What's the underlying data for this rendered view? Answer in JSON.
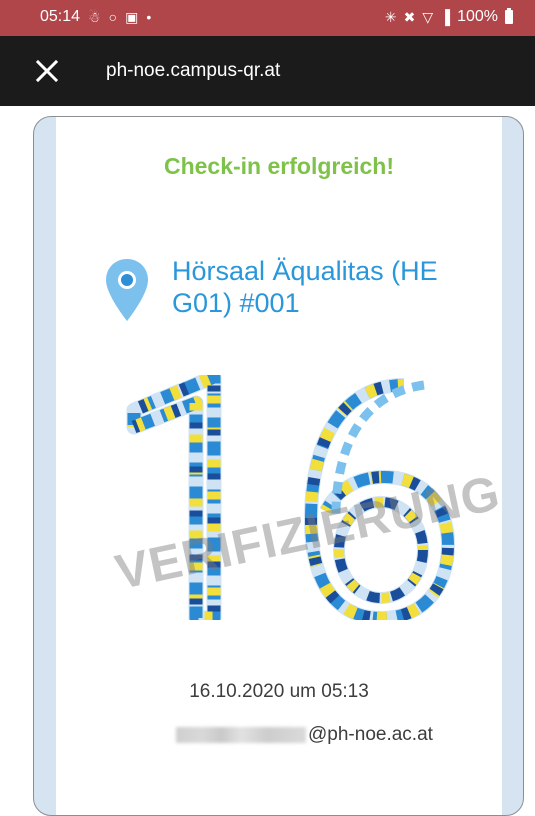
{
  "status_bar": {
    "time": "05:14",
    "battery": "100%",
    "color": "#b0454a",
    "left_icons": [
      "person-icon",
      "whatsapp-icon",
      "gallery-icon",
      "dot-icon"
    ],
    "right_icons": [
      "bluetooth-icon",
      "mute-icon",
      "wifi-icon",
      "signal-icon",
      "battery-icon"
    ]
  },
  "app_bar": {
    "url": "ph-noe.campus-qr.at",
    "close_icon": "close-icon"
  },
  "card": {
    "status_title": "Check-in erfolgreich!",
    "status_color": "#7ec24a",
    "location": "Hörsaal Äqualitas (HE G01) #001",
    "location_color": "#2997d9",
    "number": "16",
    "watermark": "VERIFIZIERUNG",
    "timestamp": "16.10.2020 um 05:13",
    "email": "@ph-noe.ac.at"
  }
}
